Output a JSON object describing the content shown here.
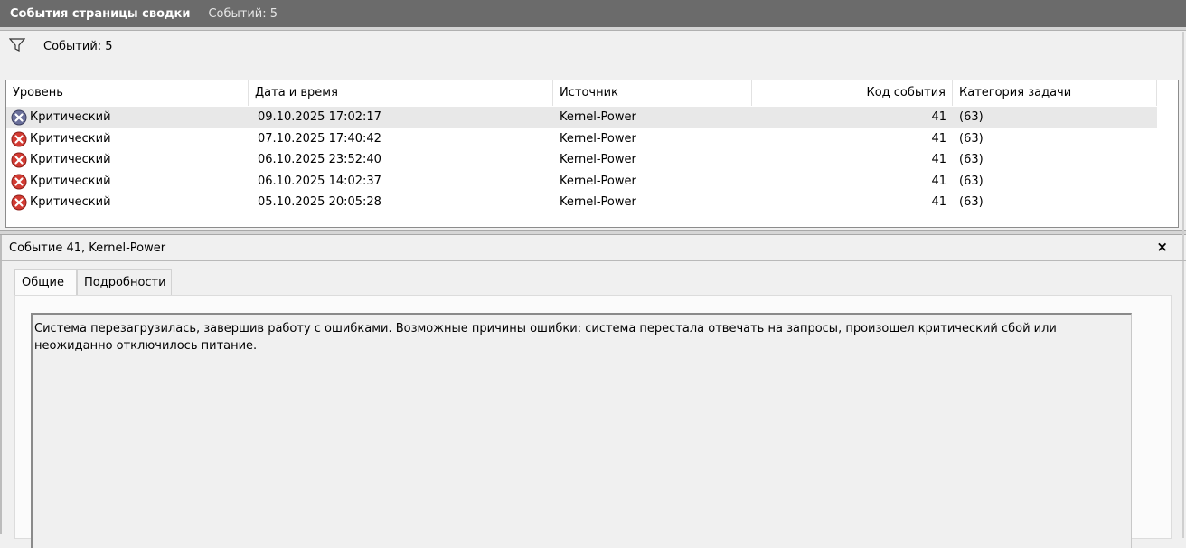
{
  "title_bar": {
    "title": "События страницы сводки",
    "count": "Событий: 5"
  },
  "filter_bar": {
    "icon": "filter-icon",
    "label": "Событий: 5"
  },
  "grid": {
    "columns": [
      "Уровень",
      "Дата и время",
      "Источник",
      "Код события",
      "Категория задачи"
    ],
    "rows": [
      {
        "level": "Критический",
        "datetime": "09.10.2025 17:02:17",
        "source": "Kernel-Power",
        "event_id": "41",
        "category": "(63)",
        "selected": true
      },
      {
        "level": "Критический",
        "datetime": "07.10.2025 17:40:42",
        "source": "Kernel-Power",
        "event_id": "41",
        "category": "(63)"
      },
      {
        "level": "Критический",
        "datetime": "06.10.2025 23:52:40",
        "source": "Kernel-Power",
        "event_id": "41",
        "category": "(63)"
      },
      {
        "level": "Критический",
        "datetime": "06.10.2025 14:02:37",
        "source": "Kernel-Power",
        "event_id": "41",
        "category": "(63)"
      },
      {
        "level": "Критический",
        "datetime": "05.10.2025 20:05:28",
        "source": "Kernel-Power",
        "event_id": "41",
        "category": "(63)"
      }
    ]
  },
  "detail": {
    "title": "Событие 41, Kernel-Power",
    "close_label": "×",
    "tabs": [
      {
        "label": "Общие",
        "active": true
      },
      {
        "label": "Подробности"
      }
    ],
    "description_line1": "Система перезагрузилась, завершив работу с ошибками. Возможные причины ошибки: система перестала отвечать на запросы, произошел критический сбой или",
    "description_line2": "неожиданно отключилось питание."
  },
  "colors": {
    "titlebar_bg": "#6b6b6b",
    "error_icon": "#c0392b",
    "selected_row": "#e8e8e8"
  }
}
